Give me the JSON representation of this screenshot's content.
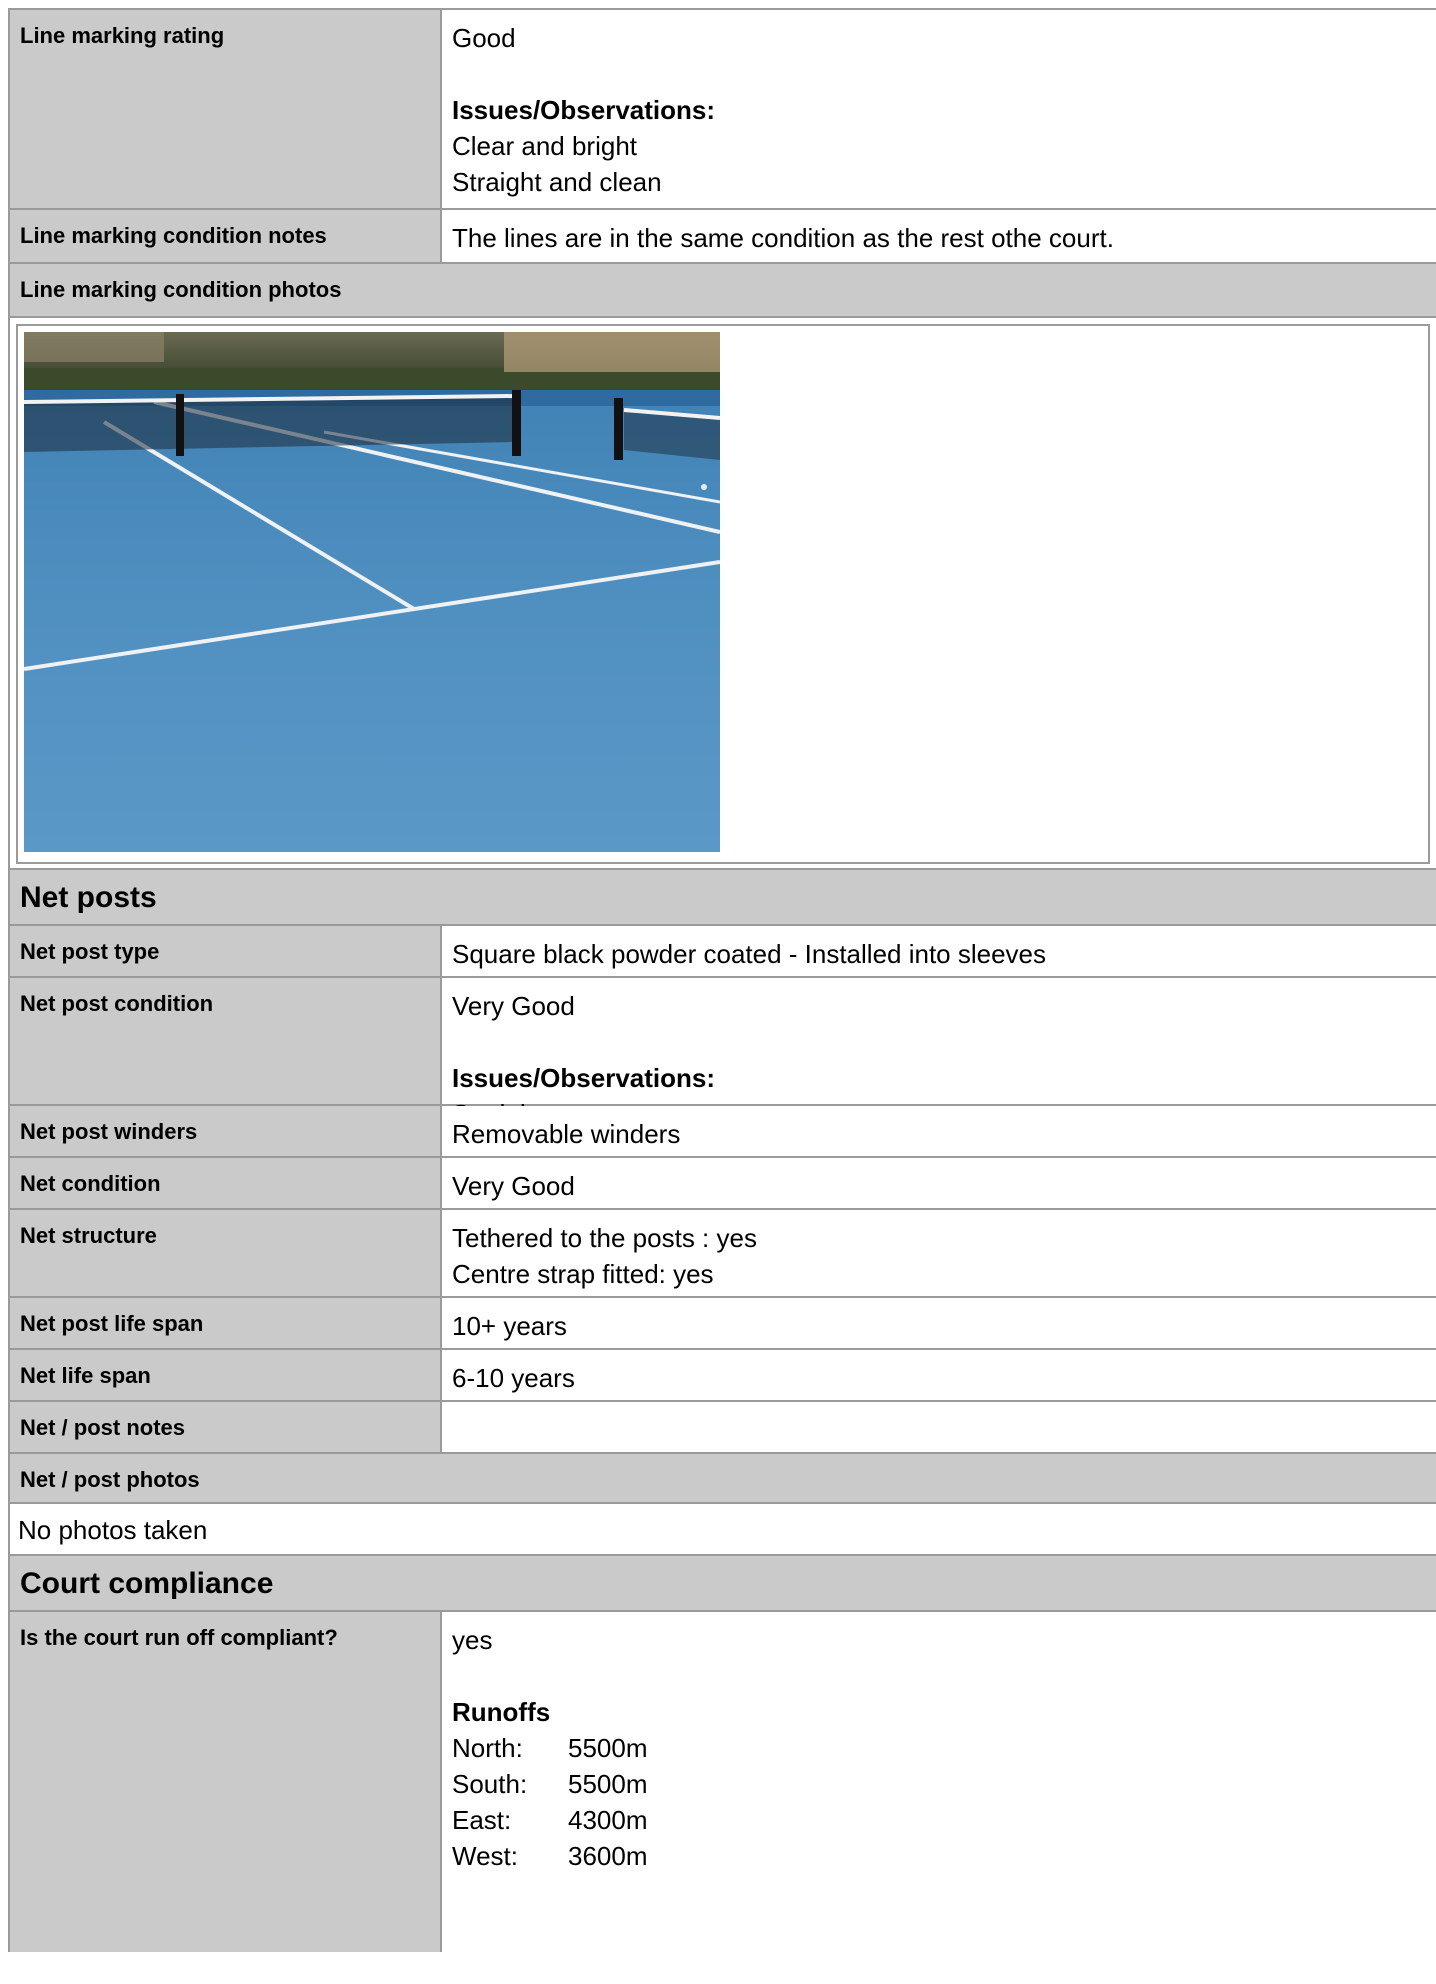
{
  "line_marking": {
    "rating_label": "Line marking rating",
    "rating_value": "Good",
    "issues_title": "Issues/Observations:",
    "issues": [
      "Clear and bright",
      "Straight and clean"
    ],
    "notes_label": "Line marking condition notes",
    "notes_value": "The lines are in the same condition as the rest othe court.",
    "photos_label": "Line marking condition photos"
  },
  "net_posts": {
    "section_title": "Net posts",
    "type_label": "Net post type",
    "type_value": "Square black powder coated - Installed into sleeves",
    "condition_label": "Net post condition",
    "condition_value": "Very Good",
    "condition_issues_title": "Issues/Observations:",
    "condition_issues": [
      "Straight"
    ],
    "winders_label": "Net post winders",
    "winders_value": "Removable winders",
    "net_condition_label": "Net condition",
    "net_condition_value": "Very Good",
    "structure_label": "Net structure",
    "structure_values": [
      "Tethered to the posts : yes",
      "Centre strap fitted: yes"
    ],
    "post_life_label": "Net post life span",
    "post_life_value": "10+ years",
    "net_life_label": "Net life span",
    "net_life_value": "6-10 years",
    "notes_label": "Net / post notes",
    "notes_value": "",
    "photos_label": "Net / post photos",
    "photos_value": "No photos taken"
  },
  "compliance": {
    "section_title": "Court compliance",
    "runoff_label": "Is the court run off compliant?",
    "runoff_value": "yes",
    "runoffs_title": "Runoffs",
    "runoffs": [
      {
        "dir": "North:",
        "val": "5500m"
      },
      {
        "dir": "South:",
        "val": "5500m"
      },
      {
        "dir": "East:",
        "val": "4300m"
      },
      {
        "dir": "West:",
        "val": "3600m"
      }
    ]
  },
  "colors": {
    "label_bg": "#cacaca",
    "border": "#9a9a9a",
    "court_blue": "#4f8fc0"
  }
}
